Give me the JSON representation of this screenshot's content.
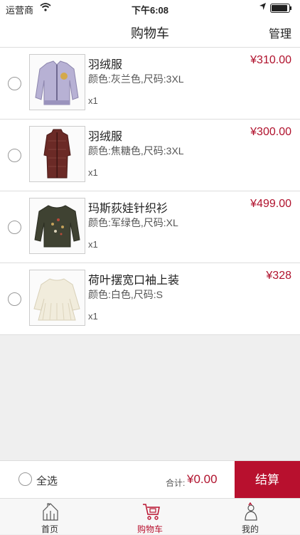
{
  "status": {
    "carrier": "运营商",
    "time": "下午6:08"
  },
  "nav": {
    "title": "购物车",
    "manage": "管理"
  },
  "items": [
    {
      "name": "羽绒服",
      "spec": "颜色:灰兰色,尺码:3XL",
      "qty": "x1",
      "price": "¥310.00"
    },
    {
      "name": "羽绒服",
      "spec": "颜色:焦糖色,尺码:3XL",
      "qty": "x1",
      "price": "¥300.00"
    },
    {
      "name": "玛斯荻娃针织衫",
      "spec": "颜色:军绿色,尺码:XL",
      "qty": "x1",
      "price": "¥499.00"
    },
    {
      "name": "荷叶摆宽口袖上装",
      "spec": "颜色:白色,尺码:S",
      "qty": "x1",
      "price": "¥328"
    }
  ],
  "footer": {
    "select_all": "全选",
    "total_label": "合计:",
    "total": "¥0.00",
    "checkout": "结算"
  },
  "tabs": [
    {
      "label": "首页",
      "icon": "home-icon",
      "active": false
    },
    {
      "label": "购物车",
      "icon": "cart-icon",
      "active": true
    },
    {
      "label": "我的",
      "icon": "profile-icon",
      "active": false
    }
  ],
  "colors": {
    "accent": "#b8102e",
    "price": "#b0122d"
  }
}
